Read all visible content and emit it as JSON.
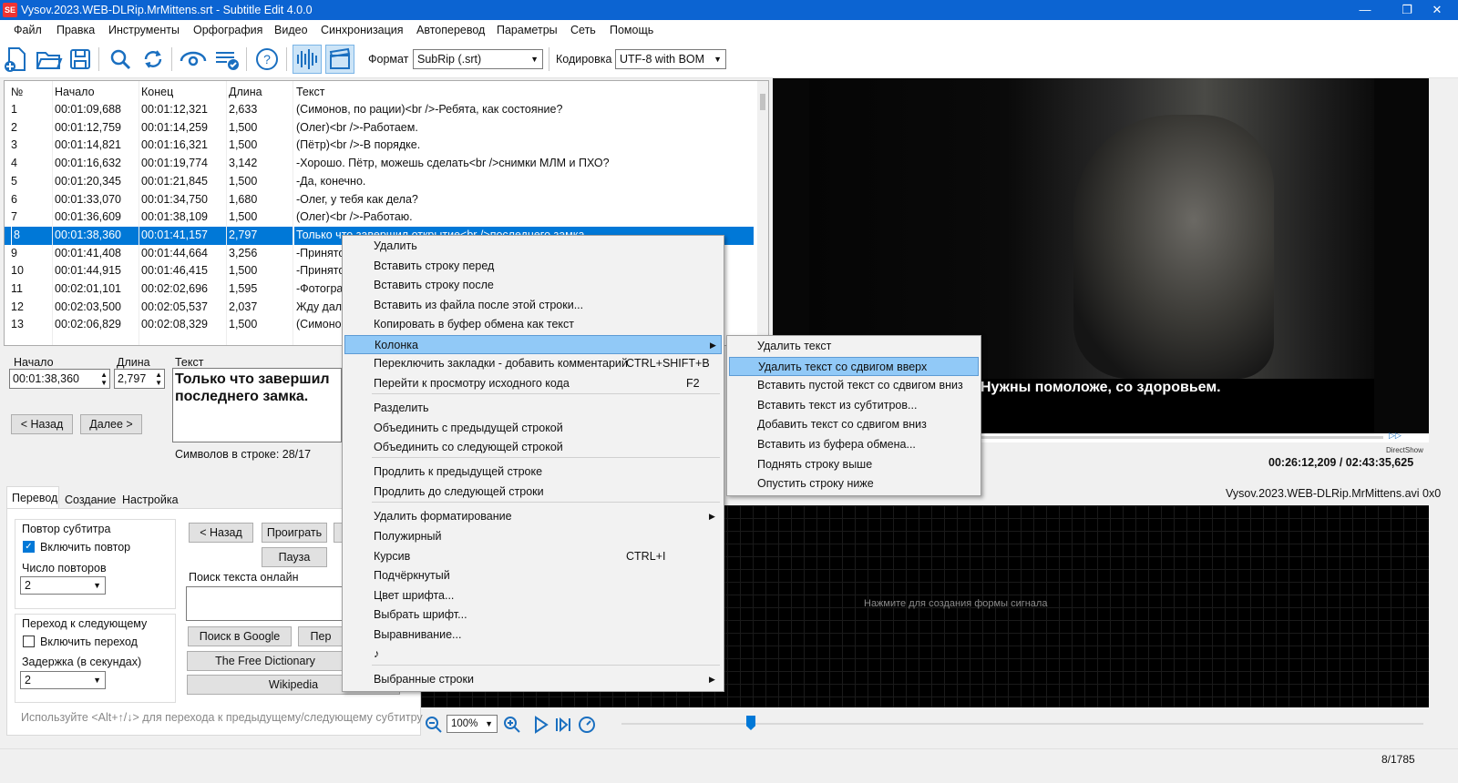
{
  "window": {
    "title": "Vysov.2023.WEB-DLRip.MrMittens.srt - Subtitle Edit 4.0.0",
    "icon_text": "SE",
    "controls": [
      "minimize-icon",
      "maximize-icon",
      "close-icon"
    ]
  },
  "menu": [
    "Файл",
    "Правка",
    "Инструменты",
    "Орфография",
    "Видео",
    "Синхронизация",
    "Автоперевод",
    "Параметры",
    "Сеть",
    "Помощь"
  ],
  "toolbar": {
    "format_label": "Формат",
    "format_value": "SubRip (.srt)",
    "encoding_label": "Кодировка",
    "encoding_value": "UTF-8 with BOM"
  },
  "grid": {
    "headers": [
      "№",
      "Начало",
      "Конец",
      "Длина",
      "Текст"
    ],
    "rows": [
      [
        "1",
        "00:01:09,688",
        "00:01:12,321",
        "2,633",
        "(Симонов, по рации)<br />-Ребята, как состояние?"
      ],
      [
        "2",
        "00:01:12,759",
        "00:01:14,259",
        "1,500",
        "(Олег)<br />-Работаем."
      ],
      [
        "3",
        "00:01:14,821",
        "00:01:16,321",
        "1,500",
        "(Пётр)<br />-В порядке."
      ],
      [
        "4",
        "00:01:16,632",
        "00:01:19,774",
        "3,142",
        "-Хорошо. Пётр, можешь сделать<br />снимки МЛМ и ПХО?"
      ],
      [
        "5",
        "00:01:20,345",
        "00:01:21,845",
        "1,500",
        "-Да, конечно."
      ],
      [
        "6",
        "00:01:33,070",
        "00:01:34,750",
        "1,680",
        "-Олег, у тебя как дела?"
      ],
      [
        "7",
        "00:01:36,609",
        "00:01:38,109",
        "1,500",
        "(Олег)<br />-Работаю."
      ],
      [
        "8",
        "00:01:38,360",
        "00:01:41,157",
        "2,797",
        "Только что завершил открытие<br />последнего замка."
      ],
      [
        "9",
        "00:01:41,408",
        "00:01:44,664",
        "3,256",
        "-Принято."
      ],
      [
        "10",
        "00:01:44,915",
        "00:01:46,415",
        "1,500",
        "-Принято."
      ],
      [
        "11",
        "00:02:01,101",
        "00:02:02,696",
        "1,595",
        "-Фотографии..."
      ],
      [
        "12",
        "00:02:03,500",
        "00:02:05,537",
        "2,037",
        "Жду дальнейших указаний."
      ],
      [
        "13",
        "00:02:06,829",
        "00:02:08,329",
        "1,500",
        "(Симонов)"
      ]
    ]
  },
  "edit": {
    "start_label": "Начало",
    "start_value": "00:01:38,360",
    "duration_label": "Длина",
    "duration_value": "2,797",
    "text_label": "Текст",
    "text_line1": "Только что завершил",
    "text_line2": "последнего замка.",
    "prev": "< Назад",
    "next": "Далее >",
    "chars": "Символов в строке: 28/17"
  },
  "tabs": [
    "Перевод",
    "Создание",
    "Настройка"
  ],
  "repeat": {
    "title": "Повтор субтитра",
    "enable": "Включить повтор",
    "count_label": "Число повторов",
    "count_value": "2"
  },
  "next_sub": {
    "title": "Переход к следующему",
    "enable": "Включить переход",
    "delay_label": "Задержка (в секундах)",
    "delay_value": "2"
  },
  "playback": {
    "back": "< Назад",
    "play": "Проиграть",
    "pause": "Пауза",
    "search_label": "Поиск текста онлайн",
    "google": "Поиск в Google",
    "translate": "Пер",
    "freedict": "The Free Dictionary",
    "wiki": "Wikipedia"
  },
  "hint": "Используйте <Alt+↑/↓> для перехода к предыдущему/следующему субтитру",
  "video": {
    "subtitle": "Нужны помоложе, со здоровьем.",
    "time": "00:26:12,209 / 02:43:35,625",
    "renderer": "DirectShow",
    "filename": "Vysov.2023.WEB-DLRip.MrMittens.avi 0x0"
  },
  "waveform": {
    "hint": "Нажмите для создания формы сигнала",
    "zoom": "100%"
  },
  "status": {
    "count": "8/1785"
  },
  "context_menu": {
    "items": [
      {
        "label": "Удалить"
      },
      {
        "label": "Вставить строку перед"
      },
      {
        "label": "Вставить строку после"
      },
      {
        "label": "Вставить из файла после этой строки..."
      },
      {
        "label": "Копировать в буфер обмена как текст"
      },
      {
        "label": "Колонка",
        "submenu": true,
        "highlight": true
      },
      {
        "label": "Переключить закладки - добавить комментарий",
        "shortcut": "CTRL+SHIFT+B"
      },
      {
        "label": "Перейти к просмотру исходного кода",
        "shortcut": "F2"
      },
      {
        "label": "Разделить"
      },
      {
        "label": "Объединить с предыдущей строкой"
      },
      {
        "label": "Объединить со следующей строкой"
      },
      {
        "label": "Продлить к предыдущей строке"
      },
      {
        "label": "Продлить до следующей строки"
      },
      {
        "label": "Удалить форматирование",
        "submenu": true
      },
      {
        "label": "Полужирный"
      },
      {
        "label": "Курсив",
        "shortcut": "CTRL+I"
      },
      {
        "label": "Подчёркнутый"
      },
      {
        "label": "Цвет шрифта..."
      },
      {
        "label": "Выбрать шрифт..."
      },
      {
        "label": "Выравнивание..."
      },
      {
        "label": "♪"
      },
      {
        "label": "Выбранные строки",
        "submenu": true
      }
    ]
  },
  "submenu": {
    "items": [
      "Удалить текст",
      "Удалить текст со сдвигом вверх",
      "Вставить пустой текст со сдвигом вниз",
      "Вставить текст из субтитров...",
      "Добавить текст со сдвигом вниз",
      "Вставить из буфера обмена...",
      "Поднять строку выше",
      "Опустить строку ниже"
    ],
    "highlight_index": 1
  },
  "colors": {
    "accent": "#0078d7",
    "titlebar": "#0c64d2",
    "menu_highlight": "#91c9f7"
  }
}
